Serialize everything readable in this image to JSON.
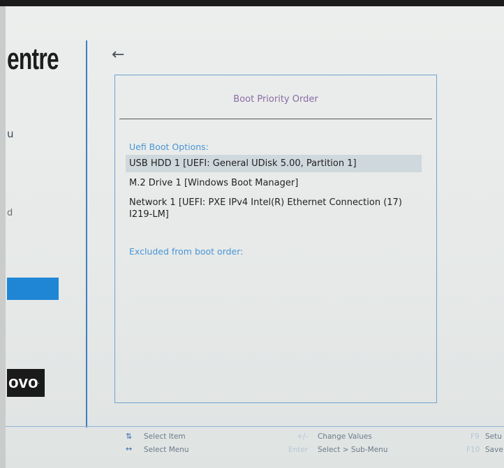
{
  "left_panel": {
    "brand_text": "entre",
    "item_1": "u",
    "item_2": "d",
    "logo_text": "ovo",
    "logo_mark": "."
  },
  "header": {
    "back_icon": "←"
  },
  "dialog": {
    "title": "Boot Priority Order",
    "uefi_label": "Uefi Boot Options:",
    "boot_options": [
      {
        "label": "USB HDD 1 [UEFI: General UDisk 5.00, Partition 1]"
      },
      {
        "label": "M.2 Drive 1 [Windows Boot Manager]"
      },
      {
        "label": "Network 1 [UEFI: PXE IPv4 Intel(R) Ethernet Connection (17) I219-LM]"
      }
    ],
    "excluded_label": "Excluded from boot order:"
  },
  "footer": {
    "select_item_glyph": "⇅",
    "select_item": "Select Item",
    "select_menu_glyph": "↔",
    "select_menu": "Select Menu",
    "change_key": "+/-",
    "change_values": "Change Values",
    "enter_key": "Enter",
    "select_submenu": "Select > Sub-Menu",
    "f9_key": "F9",
    "f9_label": "Setu",
    "f10_key": "F10",
    "f10_label": "Save"
  },
  "colors": {
    "accent": "#1f86d6",
    "panel_border": "#6fa3d2",
    "title": "#8a6ba3",
    "section_label": "#4a95d6",
    "selected_row": "#cfd8dc"
  }
}
